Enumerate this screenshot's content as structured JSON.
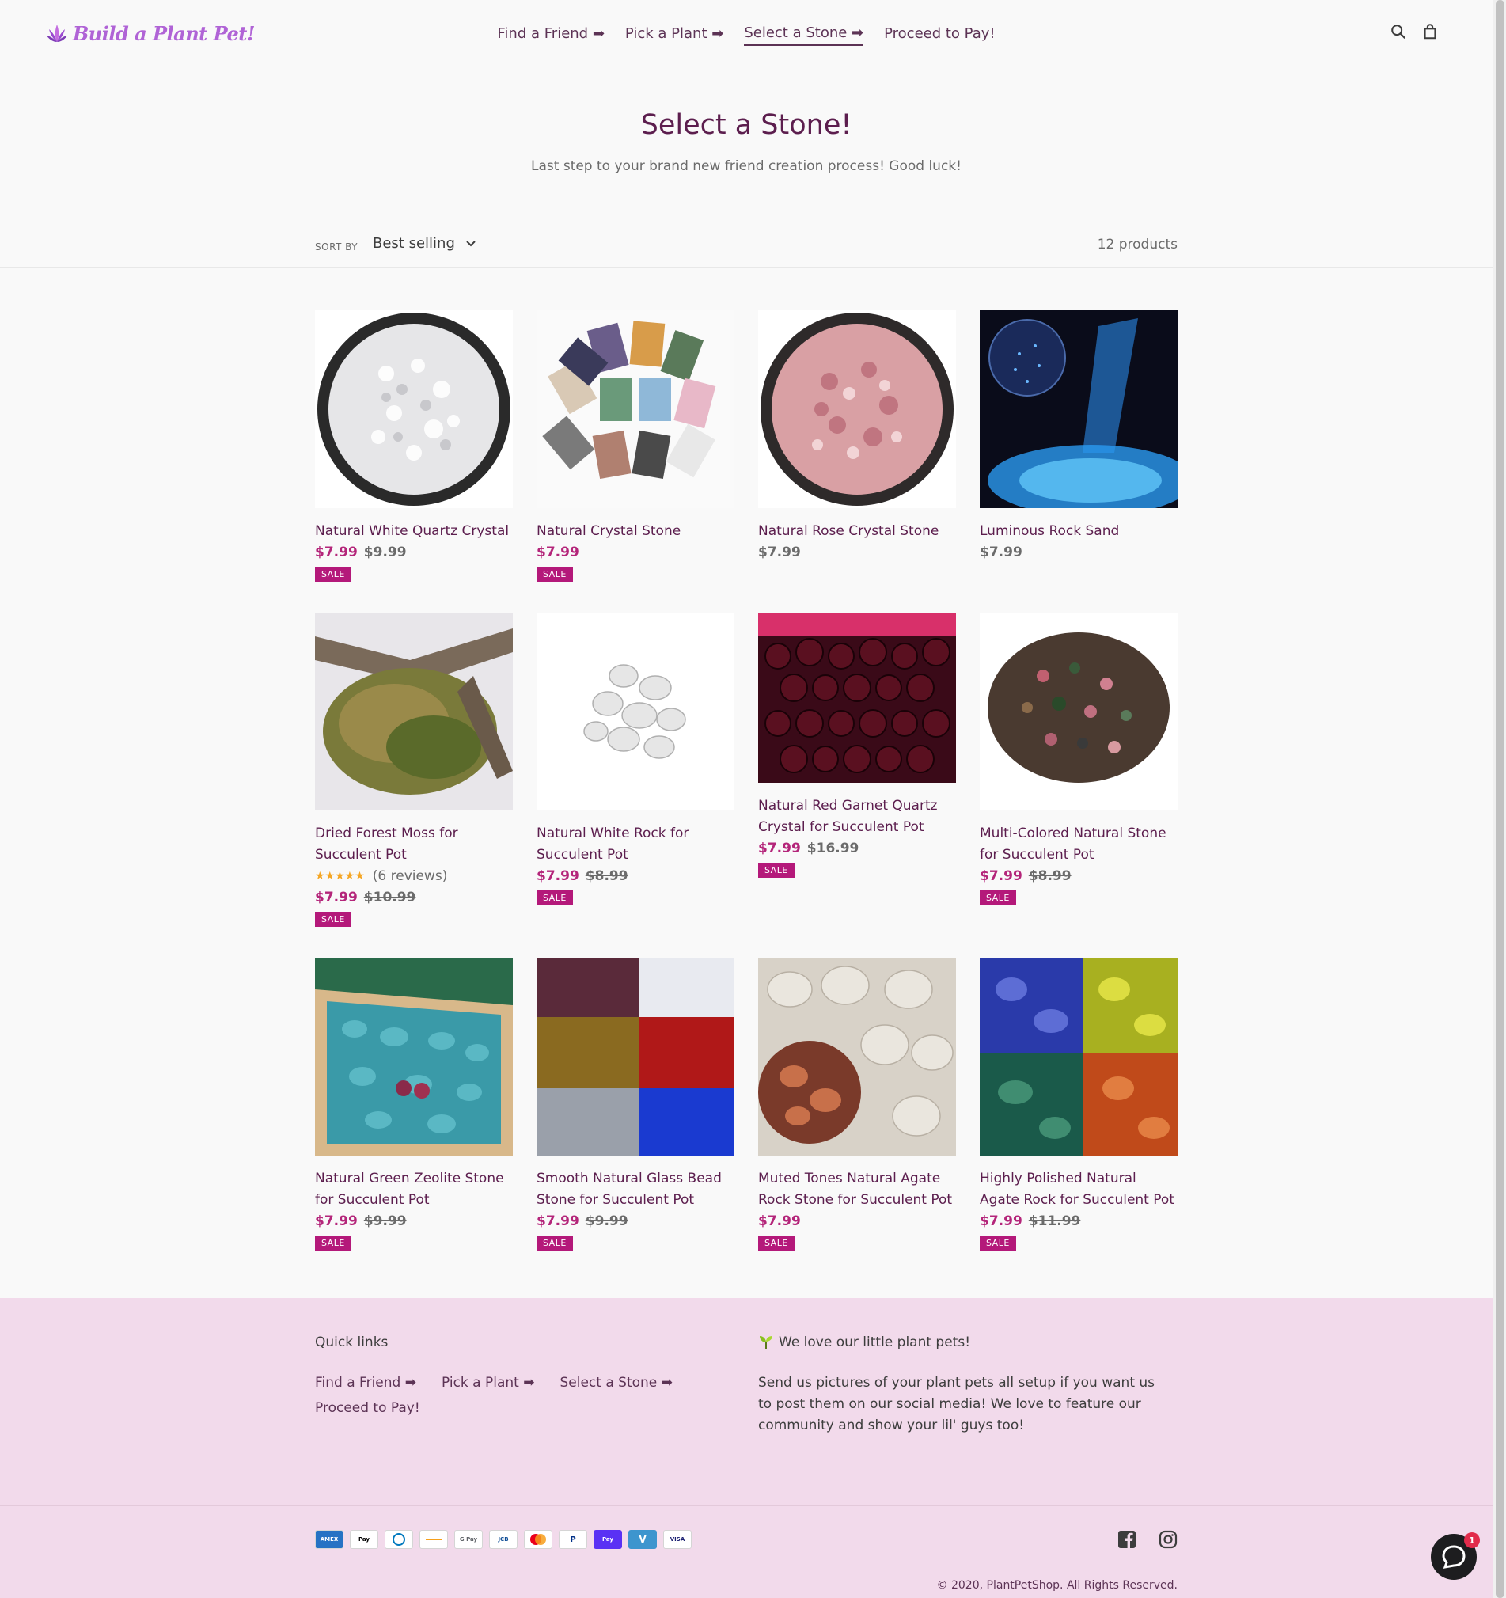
{
  "header": {
    "logo_text": "Build a Plant Pet!",
    "nav": [
      {
        "label": "Find a Friend ➡"
      },
      {
        "label": "Pick a Plant ➡"
      },
      {
        "label": "Select a Stone ➡"
      },
      {
        "label": "Proceed to Pay!"
      }
    ],
    "active_nav": "Select a Stone ➡",
    "icons": [
      "search-icon",
      "cart-icon"
    ]
  },
  "hero": {
    "title": "Select a Stone!",
    "subtitle": "Last step to your brand new friend creation process! Good luck!"
  },
  "filters": {
    "sort_label": "SORT BY",
    "sort_value": "Best selling",
    "count": "12 products"
  },
  "products": [
    {
      "title": "Natural White Quartz Crystal",
      "price": "$7.99",
      "compare": "$9.99",
      "badge": "SALE",
      "image": "white-quartz"
    },
    {
      "title": "Natural Crystal Stone",
      "price": "$7.99",
      "compare": "",
      "badge": "SALE",
      "image": "crystal-bags"
    },
    {
      "title": "Natural Rose Crystal Stone",
      "price": "$7.99",
      "compare": "",
      "badge": "",
      "image": "rose-crystal"
    },
    {
      "title": "Luminous Rock Sand",
      "price": "$7.99",
      "compare": "",
      "badge": "",
      "image": "luminous-sand"
    },
    {
      "title": "Dried Forest Moss for Succulent Pot",
      "price": "$7.99",
      "compare": "$10.99",
      "badge": "SALE",
      "rating": "(6 reviews)",
      "rating_value": 4.5,
      "image": "moss"
    },
    {
      "title": "Natural White Rock for Succulent Pot",
      "price": "$7.99",
      "compare": "$8.99",
      "badge": "SALE",
      "image": "white-rock"
    },
    {
      "title": "Natural Red Garnet Quartz Crystal for Succulent Pot",
      "price": "$7.99",
      "compare": "$16.99",
      "badge": "SALE",
      "image": "garnet"
    },
    {
      "title": "Multi-Colored Natural Stone for Succulent Pot",
      "price": "$7.99",
      "compare": "$8.99",
      "badge": "SALE",
      "image": "multi-stone"
    },
    {
      "title": "Natural Green Zeolite Stone for Succulent Pot",
      "price": "$7.99",
      "compare": "$9.99",
      "badge": "SALE",
      "image": "zeolite"
    },
    {
      "title": "Smooth Natural Glass Bead Stone for Succulent Pot",
      "price": "$7.99",
      "compare": "$9.99",
      "badge": "SALE",
      "image": "glass-beads"
    },
    {
      "title": "Muted Tones Natural Agate Rock Stone for Succulent Pot",
      "price": "$7.99",
      "compare": "",
      "badge": "SALE",
      "image": "agate-muted"
    },
    {
      "title": "Highly Polished Natural Agate Rock for Succulent Pot",
      "price": "$7.99",
      "compare": "$11.99",
      "badge": "SALE",
      "image": "agate-polished"
    }
  ],
  "footer": {
    "quick_links_title": "Quick links",
    "quick_links": [
      "Find a Friend ➡",
      "Pick a Plant ➡",
      "Select a Stone ➡",
      "Proceed to Pay!"
    ],
    "about_title": "We love our little plant pets!",
    "about_text": "Send us pictures of your plant pets all setup if you want us to post them on our social media! We love to feature our community and show your lil' guys too!",
    "payment_icons": [
      "AMEX",
      "Pay",
      "",
      "",
      "G Pay",
      "JCB",
      "",
      "P",
      "Pay",
      "V",
      "VISA"
    ],
    "social": [
      "facebook-icon",
      "instagram-icon"
    ],
    "copyright": "© 2020, PlantPetShop. All Rights Reserved."
  },
  "chat": {
    "notification_count": "1"
  },
  "colors": {
    "accent": "#b4257a",
    "brand": "#5c1e4e",
    "footer_bg": "#f2daeb",
    "badge": "#b4197a"
  }
}
